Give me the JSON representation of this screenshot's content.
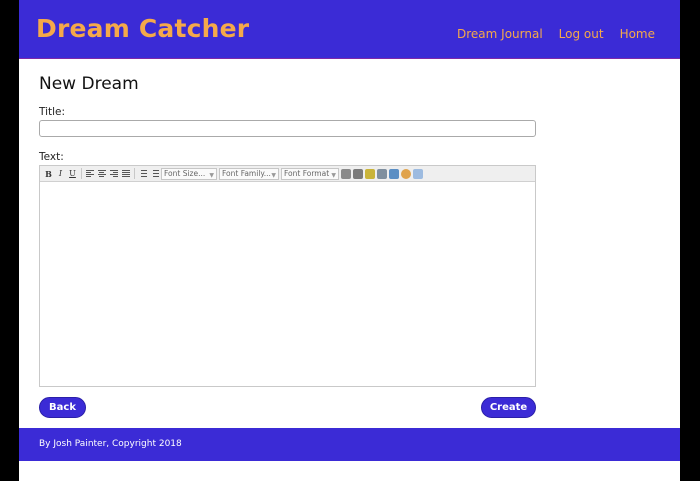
{
  "navbar": {
    "brand": "Dream Catcher",
    "links": [
      "Dream Journal",
      "Log out",
      "Home"
    ]
  },
  "main": {
    "page_title": "New Dream",
    "title_label": "Title:",
    "title_value": "",
    "text_label": "Text:",
    "editor": {
      "font_size_placeholder": "Font Size...",
      "font_family_placeholder": "Font Family...",
      "font_format_placeholder": "Font Format"
    },
    "back_label": "Back",
    "create_label": "Create"
  },
  "footer": {
    "text": "By Josh Painter, Copyright 2018"
  },
  "colors": {
    "brand_bg": "#3b2bd6",
    "accent": "#f5a94a"
  }
}
